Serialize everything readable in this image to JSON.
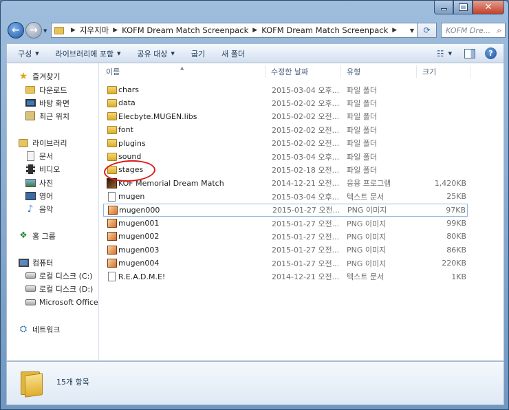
{
  "window": {
    "caption_buttons": {
      "minimize": "",
      "maximize": "",
      "close": "✕"
    }
  },
  "address": {
    "breadcrumbs": [
      "지우지마",
      "KOFM Dream Match Screenpack",
      "KOFM Dream Match Screenpack"
    ],
    "search_placeholder": "KOFM Dre..."
  },
  "toolbar": {
    "organize": "구성",
    "include_library": "라이브러리에 포함",
    "share_with": "공유 대상",
    "burn": "굽기",
    "new_folder": "새 폴더"
  },
  "sidebar": {
    "favorites": "즐겨찾기",
    "downloads": "다운로드",
    "desktop": "바탕 화면",
    "recent": "최근 위치",
    "libraries": "라이브러리",
    "documents": "문서",
    "video": "비디오",
    "pictures": "사진",
    "movies": "영어",
    "music": "음악",
    "homegroup": "홈 그룹",
    "computer": "컴퓨터",
    "drive_c": "로컬 디스크 (C:)",
    "drive_d": "로컬 디스크 (D:)",
    "drive_office": "Microsoft Office",
    "network": "네트워크"
  },
  "columns": {
    "name": "이름",
    "date": "수정한 날짜",
    "type": "유형",
    "size": "크기"
  },
  "files": [
    {
      "name": "chars",
      "date": "2015-03-04 오후...",
      "type": "파일 폴더",
      "size": "",
      "icon": "folder"
    },
    {
      "name": "data",
      "date": "2015-02-02 오후...",
      "type": "파일 폴더",
      "size": "",
      "icon": "folder"
    },
    {
      "name": "Elecbyte.MUGEN.libs",
      "date": "2015-02-02 오전...",
      "type": "파일 폴더",
      "size": "",
      "icon": "folder"
    },
    {
      "name": "font",
      "date": "2015-02-02 오전...",
      "type": "파일 폴더",
      "size": "",
      "icon": "folder"
    },
    {
      "name": "plugins",
      "date": "2015-02-02 오전...",
      "type": "파일 폴더",
      "size": "",
      "icon": "folder"
    },
    {
      "name": "sound",
      "date": "2015-03-04 오후...",
      "type": "파일 폴더",
      "size": "",
      "icon": "folder"
    },
    {
      "name": "stages",
      "date": "2015-02-18 오전...",
      "type": "파일 폴더",
      "size": "",
      "icon": "folder"
    },
    {
      "name": "KOF Memorial Dream Match",
      "date": "2014-12-21 오전...",
      "type": "응용 프로그램",
      "size": "1,420KB",
      "icon": "exe"
    },
    {
      "name": "mugen",
      "date": "2015-03-04 오후...",
      "type": "텍스트 문서",
      "size": "25KB",
      "icon": "file"
    },
    {
      "name": "mugen000",
      "date": "2015-01-27 오전...",
      "type": "PNG 이미지",
      "size": "97KB",
      "icon": "png"
    },
    {
      "name": "mugen001",
      "date": "2015-01-27 오전...",
      "type": "PNG 이미지",
      "size": "99KB",
      "icon": "png"
    },
    {
      "name": "mugen002",
      "date": "2015-01-27 오전...",
      "type": "PNG 이미지",
      "size": "80KB",
      "icon": "png"
    },
    {
      "name": "mugen003",
      "date": "2015-01-27 오전...",
      "type": "PNG 이미지",
      "size": "86KB",
      "icon": "png"
    },
    {
      "name": "mugen004",
      "date": "2015-01-27 오전...",
      "type": "PNG 이미지",
      "size": "220KB",
      "icon": "png"
    },
    {
      "name": "R.E.A.D.M.E!",
      "date": "2014-12-21 오전...",
      "type": "텍스트 문서",
      "size": "1KB",
      "icon": "file"
    }
  ],
  "selected_file": "mugen000",
  "status": {
    "item_count": "15개 항목"
  },
  "colors": {
    "annotation": "#e01818",
    "selection_border": "#8fb7e3"
  }
}
